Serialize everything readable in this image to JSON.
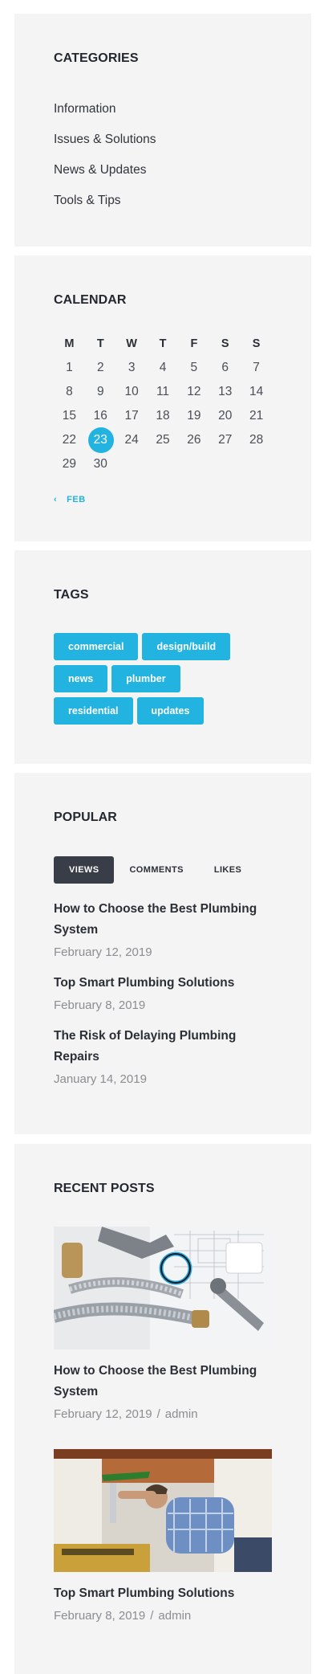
{
  "categories": {
    "title": "CATEGORIES",
    "items": [
      "Information",
      "Issues & Solutions",
      "News & Updates",
      "Tools & Tips"
    ]
  },
  "calendar": {
    "title": "CALENDAR",
    "weekdays": [
      "M",
      "T",
      "W",
      "T",
      "F",
      "S",
      "S"
    ],
    "weeks": [
      [
        "1",
        "2",
        "3",
        "4",
        "5",
        "6",
        "7"
      ],
      [
        "8",
        "9",
        "10",
        "11",
        "12",
        "13",
        "14"
      ],
      [
        "15",
        "16",
        "17",
        "18",
        "19",
        "20",
        "21"
      ],
      [
        "22",
        "23",
        "24",
        "25",
        "26",
        "27",
        "28"
      ],
      [
        "29",
        "30",
        "",
        "",
        "",
        "",
        ""
      ]
    ],
    "today": "23",
    "prev_arrow": "‹",
    "prev_label": "FEB"
  },
  "tags": {
    "title": "TAGS",
    "items": [
      "commercial",
      "design/build",
      "news",
      "plumber",
      "residential",
      "updates"
    ]
  },
  "popular": {
    "title": "POPULAR",
    "tabs": [
      "VIEWS",
      "COMMENTS",
      "LIKES"
    ],
    "active_tab": "VIEWS",
    "posts": [
      {
        "title": "How to Choose the Best Plumbing System",
        "date": "February 12, 2019"
      },
      {
        "title": "Top Smart Plumbing Solutions",
        "date": "February 8, 2019"
      },
      {
        "title": "The Risk of Delaying Plumbing Repairs",
        "date": "January 14, 2019"
      }
    ]
  },
  "recent_posts": {
    "title": "RECENT POSTS",
    "separator": "/",
    "posts": [
      {
        "title": "How to Choose the Best Plumbing System",
        "date": "February 12, 2019",
        "author": "admin",
        "image": "plumbing-tools-photo"
      },
      {
        "title": "Top Smart Plumbing Solutions",
        "date": "February 8, 2019",
        "author": "admin",
        "image": "plumber-under-sink-photo"
      }
    ]
  },
  "colors": {
    "accent": "#22b3e0",
    "dark_tab": "#383d47",
    "panel_bg": "#f4f4f4",
    "muted_text": "#8a8d92"
  }
}
